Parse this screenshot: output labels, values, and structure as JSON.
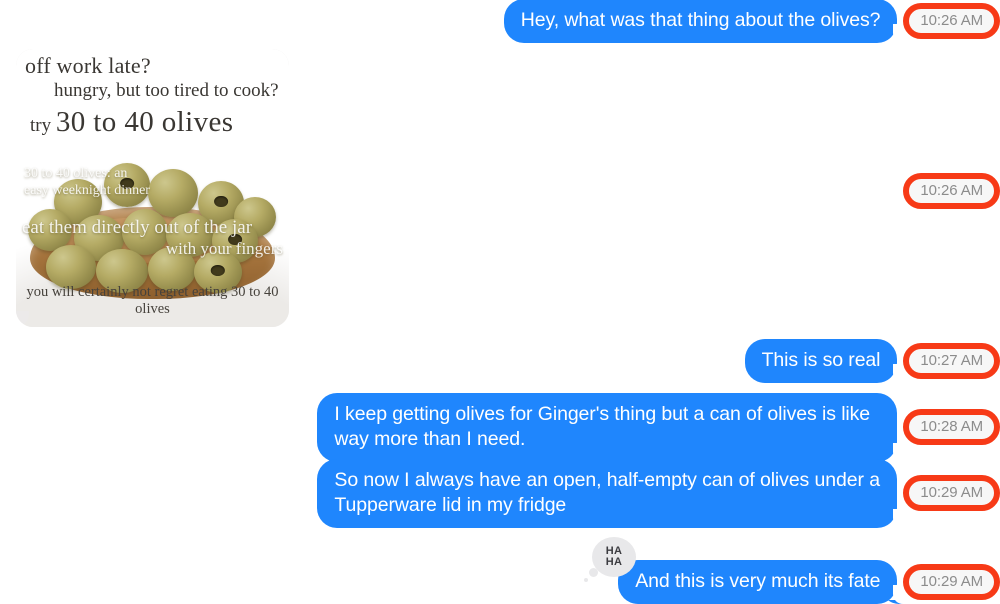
{
  "app": {
    "type": "messaging-thread",
    "background_color": "#ffffff",
    "bubble_color": "#1f86fd",
    "bubble_text_color": "#ffffff",
    "timestamp_border_color": "#f73a17",
    "timestamp_fill_color": "#f7f7f7",
    "timestamp_text_color": "#8c8c8c"
  },
  "messages": [
    {
      "id": "msg-1",
      "kind": "text",
      "side": "sent",
      "text": "Hey, what was that thing about the olives?",
      "timestamp": "10:26 AM"
    },
    {
      "id": "msg-2",
      "kind": "image",
      "side": "received",
      "timestamp": "10:26 AM",
      "image": {
        "alt": "olive meme",
        "headline_1": "off work late?",
        "headline_2": "hungry, but too tired to cook?",
        "headline_3_prefix": "try",
        "headline_3_main": "30 to 40 olives",
        "overlay_1": "30 to 40 olives: an\neasy weeknight dinner",
        "overlay_2": "eat them directly out of the jar",
        "overlay_3": "with your fingers",
        "footer": "you will certainly not regret eating 30 to 40 olives"
      }
    },
    {
      "id": "msg-3",
      "kind": "text",
      "side": "sent",
      "text": "This is so real",
      "timestamp": "10:27 AM"
    },
    {
      "id": "msg-4",
      "kind": "text",
      "side": "sent",
      "text": "I keep getting olives for Ginger's thing but a can of olives is like way more than I need.",
      "timestamp": "10:28 AM"
    },
    {
      "id": "msg-5",
      "kind": "text",
      "side": "sent",
      "text": "So now I always have an open, half-empty can of olives under a Tupperware lid in my fridge",
      "timestamp": "10:29 AM"
    },
    {
      "id": "msg-6",
      "kind": "text",
      "side": "sent",
      "text": "And this is very much its fate",
      "timestamp": "10:29 AM",
      "reaction": {
        "type": "haha-reaction",
        "line_1": "HA",
        "line_2": "HA"
      }
    }
  ]
}
